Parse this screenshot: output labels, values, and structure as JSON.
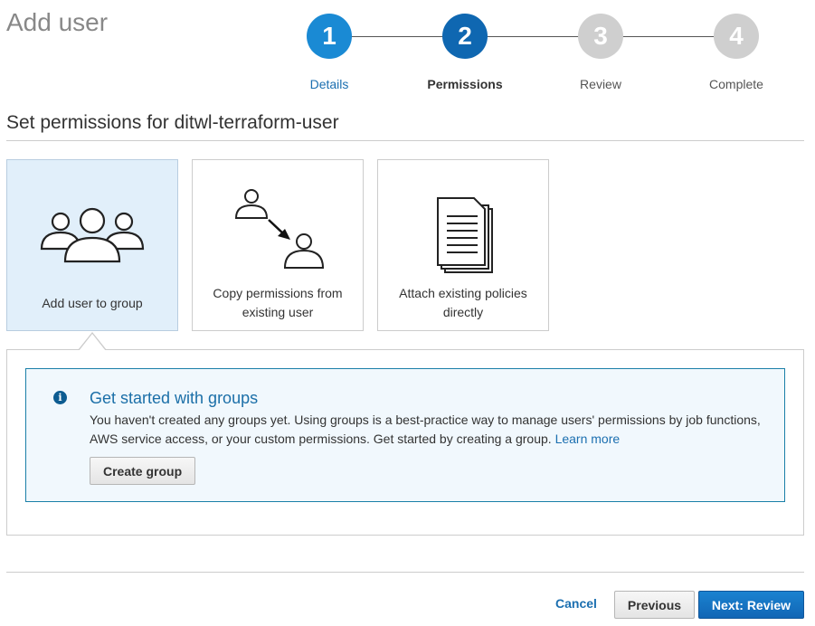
{
  "header": {
    "title": "Add user"
  },
  "steps": [
    {
      "number": "1",
      "label": "Details",
      "state": "done"
    },
    {
      "number": "2",
      "label": "Permissions",
      "state": "active"
    },
    {
      "number": "3",
      "label": "Review",
      "state": "todo"
    },
    {
      "number": "4",
      "label": "Complete",
      "state": "todo"
    }
  ],
  "section": {
    "title": "Set permissions for ditwl-terraform-user"
  },
  "options": [
    {
      "label": "Add user to group",
      "icon": "users-group-icon",
      "selected": true
    },
    {
      "label_line1": "Copy permissions from",
      "label_line2": "existing user",
      "icon": "copy-user-icon",
      "selected": false
    },
    {
      "label_line1": "Attach existing policies",
      "label_line2": "directly",
      "icon": "policy-documents-icon",
      "selected": false
    }
  ],
  "info": {
    "icon": "info-icon",
    "title": "Get started with groups",
    "text": "You haven't created any groups yet. Using groups is a best-practice way to manage users' permissions by job functions, AWS service access, or your custom permissions. Get started by creating a group. ",
    "link": "Learn more",
    "button": "Create group"
  },
  "footer": {
    "cancel": "Cancel",
    "previous": "Previous",
    "next": "Next: Review"
  },
  "colors": {
    "primary": "#1266b5",
    "step_done": "#1a8ad4",
    "step_active": "#0f67b1",
    "step_todo": "#cfcfcf",
    "selected_bg": "#e1effa",
    "info_border": "#1a7fa8"
  }
}
